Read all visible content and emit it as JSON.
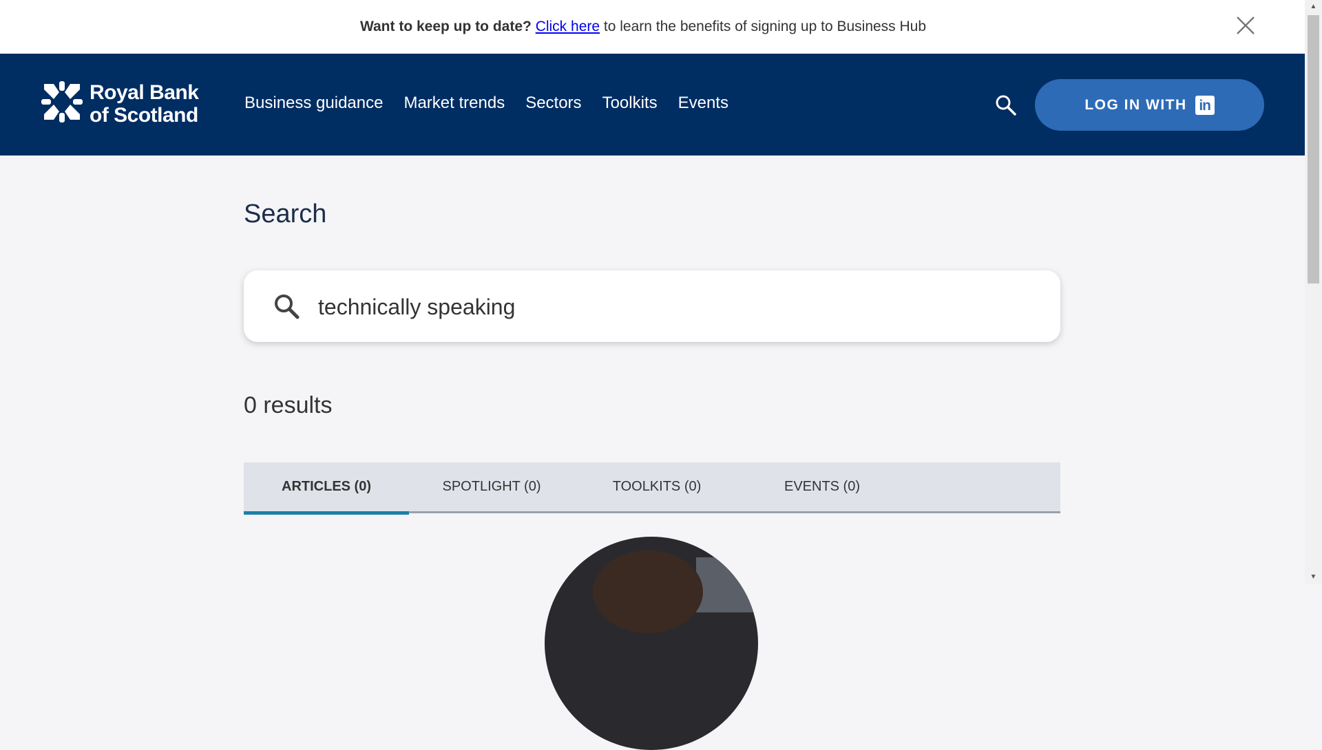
{
  "banner": {
    "lead": "Want to keep up to date?",
    "link": "Click here",
    "rest": "to learn the benefits of signing up to Business Hub",
    "close_icon": "close-icon"
  },
  "header": {
    "logo": "Royal Bank of Scotland",
    "logo_line1": "Royal Bank",
    "logo_line2": "of Scotland",
    "nav": [
      "Business guidance",
      "Market trends",
      "Sectors",
      "Toolkits",
      "Events"
    ],
    "search_icon": "search-icon",
    "login_label": "LOG IN WITH",
    "login_icon": "linkedin-icon",
    "linkedin_glyph": "in",
    "brand_color": "#002d62",
    "button_color": "#2d6bb6"
  },
  "main": {
    "title": "Search",
    "search_value": "technically speaking",
    "results": "0 results",
    "tabs": [
      {
        "label": "ARTICLES (0)",
        "active": true
      },
      {
        "label": "SPOTLIGHT (0)",
        "active": false
      },
      {
        "label": "TOOLKITS (0)",
        "active": false
      },
      {
        "label": "EVENTS (0)",
        "active": false
      }
    ],
    "tab_accent": "#1a7fa8"
  }
}
